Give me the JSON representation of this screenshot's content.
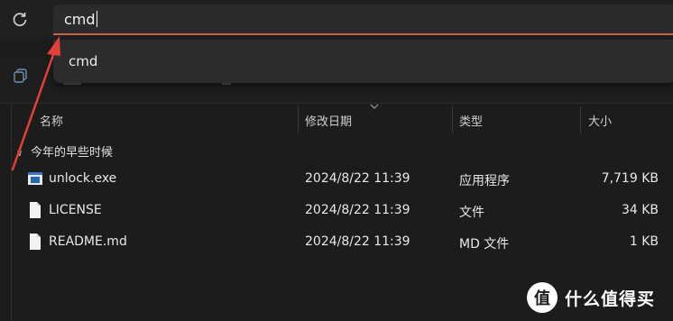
{
  "address_bar": {
    "value": "cmd"
  },
  "suggestion": {
    "item": "cmd"
  },
  "columns": {
    "name": "名称",
    "modified": "修改日期",
    "type": "类型",
    "size": "大小"
  },
  "group": {
    "label": "今年的早些时候"
  },
  "files": [
    {
      "name": "unlock.exe",
      "modified": "2024/8/22 11:39",
      "type": "应用程序",
      "size": "7,719 KB",
      "icon": "exe-icon"
    },
    {
      "name": "LICENSE",
      "modified": "2024/8/22 11:39",
      "type": "文件",
      "size": "34 KB",
      "icon": "file-icon"
    },
    {
      "name": "README.md",
      "modified": "2024/8/22 11:39",
      "type": "MD 文件",
      "size": "1 KB",
      "icon": "file-icon"
    }
  ],
  "watermark": {
    "badge": "值",
    "text": "什么值得买"
  },
  "colors": {
    "accent_underline": "#c8644a",
    "annotation_arrow": "#e0413a"
  }
}
